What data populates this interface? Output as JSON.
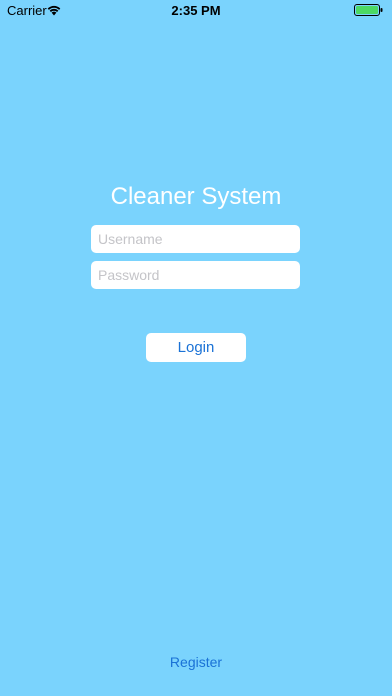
{
  "status_bar": {
    "carrier": "Carrier",
    "time": "2:35 PM",
    "wifi_icon": "wifi-icon",
    "battery_icon": "battery-icon",
    "battery_level": 1.0,
    "battery_color": "#4cd964"
  },
  "login_screen": {
    "title": "Cleaner System",
    "username_placeholder": "Username",
    "username_value": "",
    "password_placeholder": "Password",
    "password_value": "",
    "login_label": "Login",
    "register_label": "Register"
  },
  "colors": {
    "background": "#7ad3fd",
    "accent": "#1a72d6",
    "title_text": "#ffffff"
  }
}
